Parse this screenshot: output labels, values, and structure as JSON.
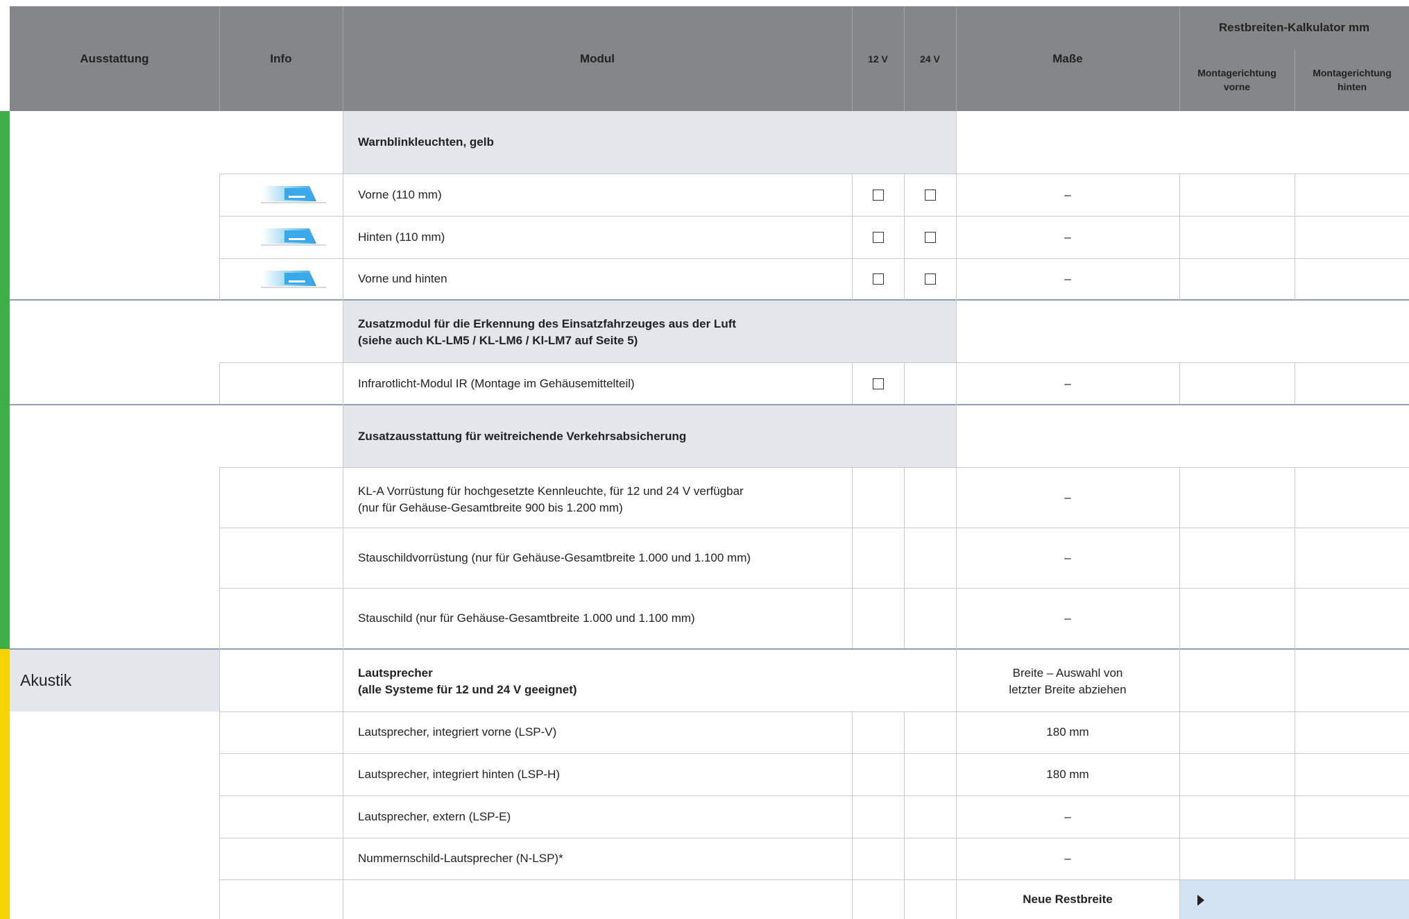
{
  "header": {
    "ausstattung": "Ausstattung",
    "info": "Info",
    "modul": "Modul",
    "v12": "12 V",
    "v24": "24 V",
    "masse": "Maße",
    "kalkulator": "Restbreiten-Kalkulator mm",
    "vorne": "Montagerichtung vorne",
    "hinten": "Montagerichtung hinten"
  },
  "colors": {
    "header": "#858687",
    "section": "#e3e6ea",
    "green": "#3eae49",
    "yellow": "#f5d400",
    "highlight": "#d3e3f3"
  },
  "sections": {
    "warn_title": "Warnblinkleuchten, gelb",
    "zusatz_title_1": "Zusatzmodul für die Erkennung des Einsatzfahrzeuges aus der Luft",
    "zusatz_title_2": "(siehe auch KL-LM5 / KL-LM6 / Kl-LM7 auf Seite 5)",
    "verkehr_title": "Zusatzausstattung für weitreichende Verkehrsabsicherung",
    "akustik_group": "Akustik",
    "laut_title_1": "Lautsprecher",
    "laut_title_2": "(alle Systeme für 12 und 24 V geeignet)",
    "laut_masse_1": "Breite – Auswahl von",
    "laut_masse_2": "letzter Breite abziehen"
  },
  "rows": {
    "vorne": {
      "modul": "Vorne (110 mm)",
      "masse": "–"
    },
    "hinten": {
      "modul": "Hinten (110 mm)",
      "masse": "–"
    },
    "beide": {
      "modul": "Vorne und hinten",
      "masse": "–"
    },
    "ir": {
      "modul": "Infrarotlicht-Modul IR (Montage im Gehäusemittelteil)",
      "masse": "–"
    },
    "kla": {
      "modul_1": "KL-A Vorrüstung für hochgesetzte Kennleuchte, für 12 und 24 V verfügbar",
      "modul_2": "(nur für Gehäuse-Gesamtbreite 900 bis 1.200 mm)",
      "masse": "–"
    },
    "stau_v": {
      "modul": "Stauschildvorrüstung (nur für Gehäuse-Gesamtbreite 1.000 und 1.100 mm)",
      "masse": "–"
    },
    "stau": {
      "modul": "Stauschild (nur für Gehäuse-Gesamtbreite 1.000 und 1.100 mm)",
      "masse": "–"
    },
    "lsp_v": {
      "modul": "Lautsprecher, integriert vorne (LSP-V)",
      "masse": "180 mm"
    },
    "lsp_h": {
      "modul": "Lautsprecher, integriert hinten (LSP-H)",
      "masse": "180 mm"
    },
    "lsp_e": {
      "modul": "Lautsprecher, extern (LSP-E)",
      "masse": "–"
    },
    "n_lsp": {
      "modul": "Nummernschild-Lautsprecher (N-LSP)*",
      "masse": "–"
    }
  },
  "footer": {
    "neue_restbreite": "Neue Restbreite"
  }
}
